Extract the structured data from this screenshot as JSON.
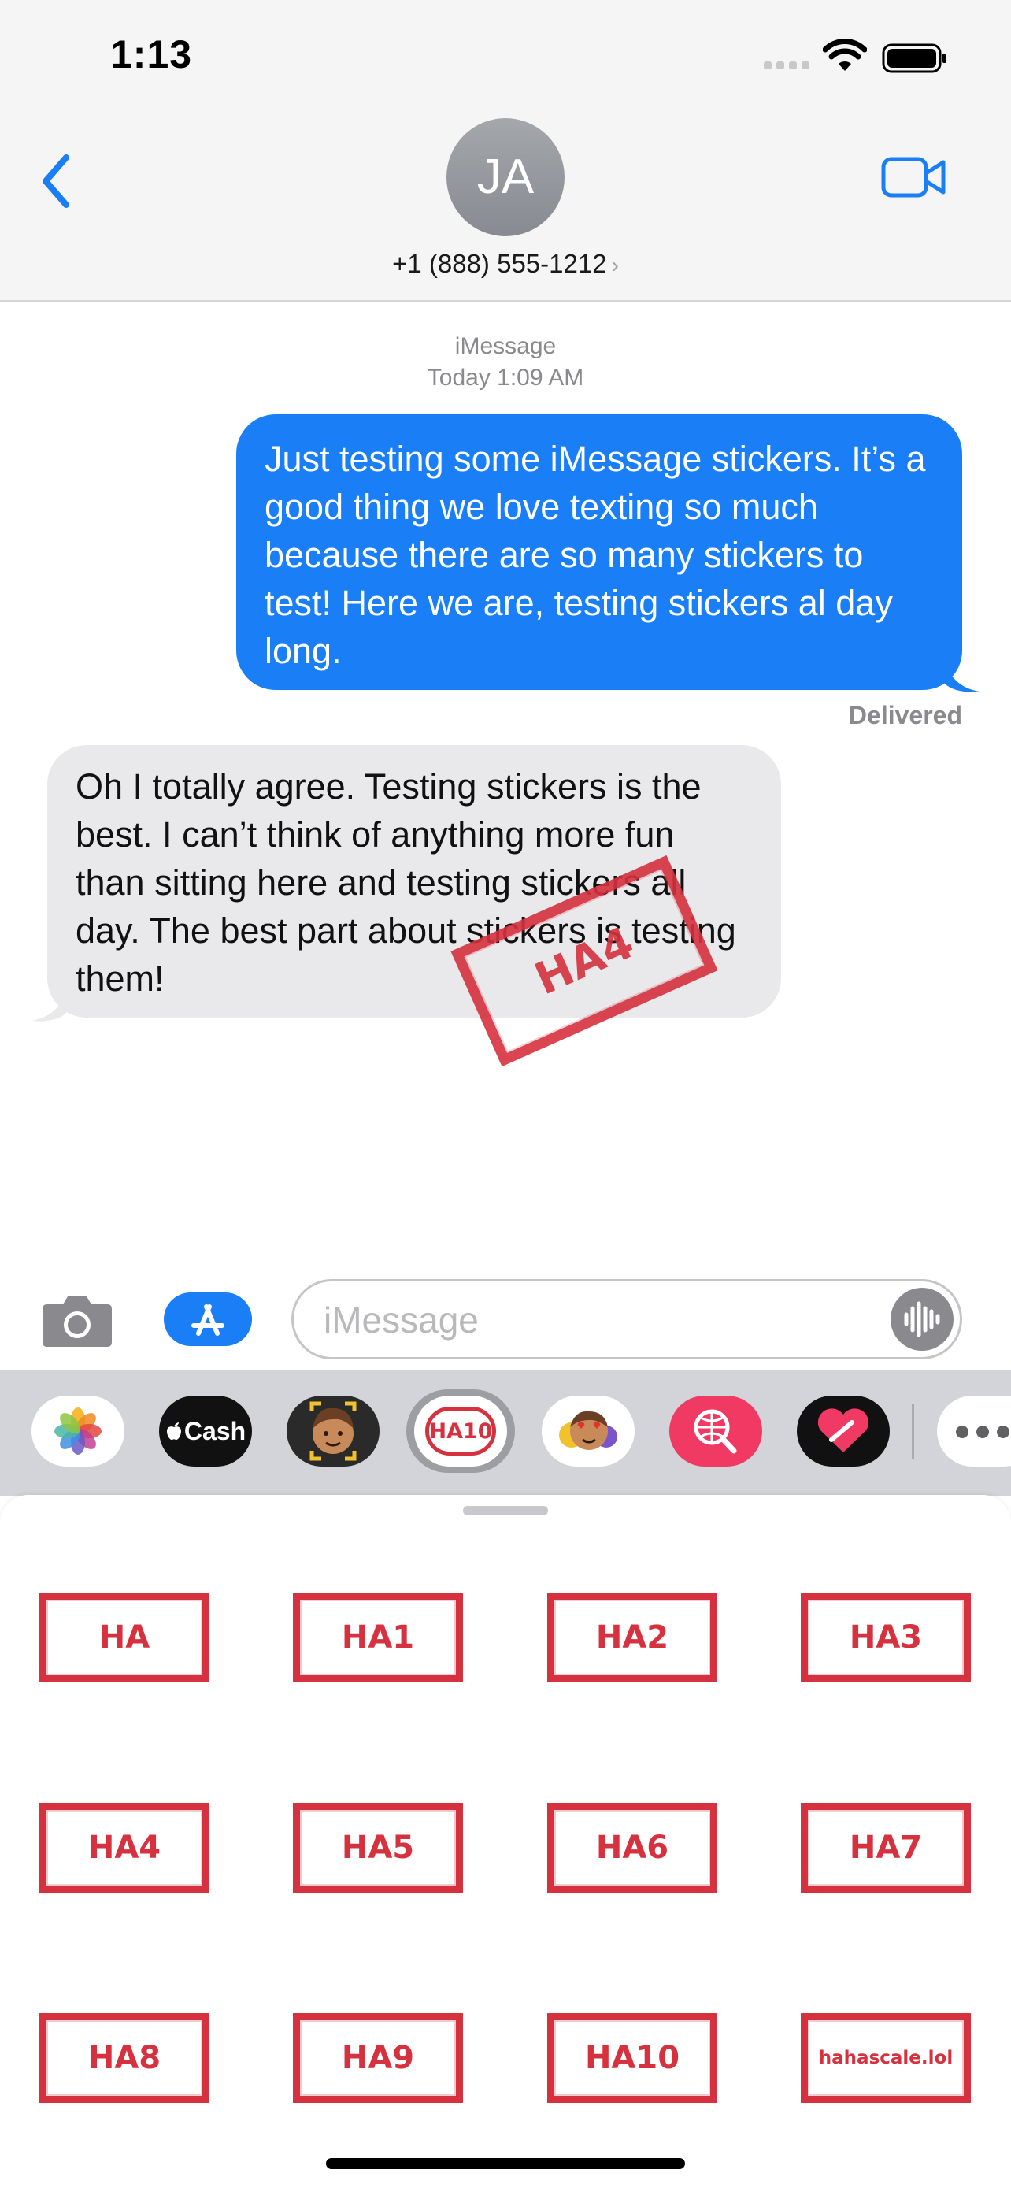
{
  "status_bar": {
    "time": "1:13"
  },
  "header": {
    "avatar_initials": "JA",
    "contact": "+1 (888) 555-1212",
    "contact_chevron": "›"
  },
  "conversation": {
    "service": "iMessage",
    "timestamp": "Today 1:09 AM",
    "messages": [
      {
        "direction": "outgoing",
        "text": "Just testing some iMessage stickers. It’s a good thing we love texting so much because there are so many stickers to test! Here we are, testing stickers al day long."
      },
      {
        "direction": "incoming",
        "text": "Oh I totally agree. Testing stickers is the best. I can’t think of anything more fun than sitting here and testing stickers all day. The best part about stickers is testing them!"
      }
    ],
    "status": "Delivered",
    "placed_sticker": "HA4"
  },
  "input": {
    "placeholder": "iMessage",
    "value": ""
  },
  "app_drawer": {
    "apps": [
      {
        "name": "Photos",
        "icon": "photos-icon"
      },
      {
        "name": "Cash",
        "label": "Cash",
        "icon": "apple-logo-icon"
      },
      {
        "name": "Memoji",
        "icon": "memoji-icon"
      },
      {
        "name": "HA10 Stickers",
        "label": "HA10",
        "selected": true
      },
      {
        "name": "Memoji Stickers",
        "icon": "memoji-stickers-icon"
      },
      {
        "name": "Search",
        "icon": "globe-search-icon"
      },
      {
        "name": "Digital Touch",
        "icon": "heart-icon"
      }
    ],
    "more_icon": "ellipsis-icon"
  },
  "stickers": [
    "HA",
    "HA1",
    "HA2",
    "HA3",
    "HA4",
    "HA5",
    "HA6",
    "HA7",
    "HA8",
    "HA9",
    "HA10",
    "hahascale.lol"
  ],
  "colors": {
    "imessage_blue": "#1a7ff7",
    "incoming_gray": "#e9e9eb",
    "stamp_red": "#d6313f"
  }
}
